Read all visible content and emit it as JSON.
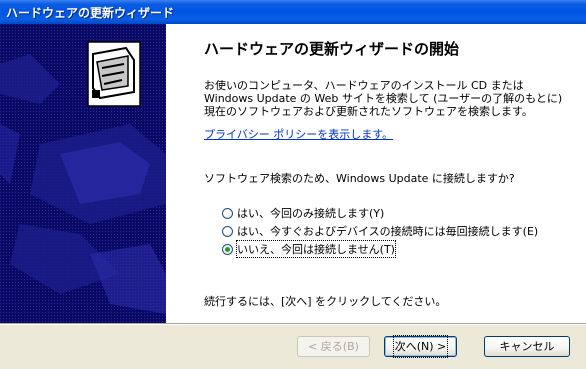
{
  "window": {
    "title": "ハードウェアの更新ウィザード"
  },
  "main": {
    "heading": "ハードウェアの更新ウィザードの開始",
    "description": "お使いのコンピュータ、ハードウェアのインストール CD または Windows Update の Web サイトを検索して (ユーザーの了解のもとに) 現在のソフトウェアおよび更新されたソフトウェアを検索します。",
    "privacy_link": "プライバシー ポリシーを表示します。",
    "question": "ソフトウェア検索のため、Windows Update に接続しますか?",
    "options": [
      {
        "label": "はい、今回のみ接続します(Y)",
        "selected": false
      },
      {
        "label": "はい、今すぐおよびデバイスの接続時には毎回接続します(E)",
        "selected": false
      },
      {
        "label": "いいえ、今回は接続しません(T)",
        "selected": true
      }
    ],
    "continue_text": "続行するには、[次へ] をクリックしてください。"
  },
  "buttons": {
    "back": "< 戻る(B)",
    "next": "次へ(N) >",
    "cancel": "キャンセル"
  },
  "colors": {
    "title_bar": "#0054e3",
    "left_panel": "#0a0a64",
    "link": "#0033cc",
    "radio_selected": "#22a022"
  }
}
